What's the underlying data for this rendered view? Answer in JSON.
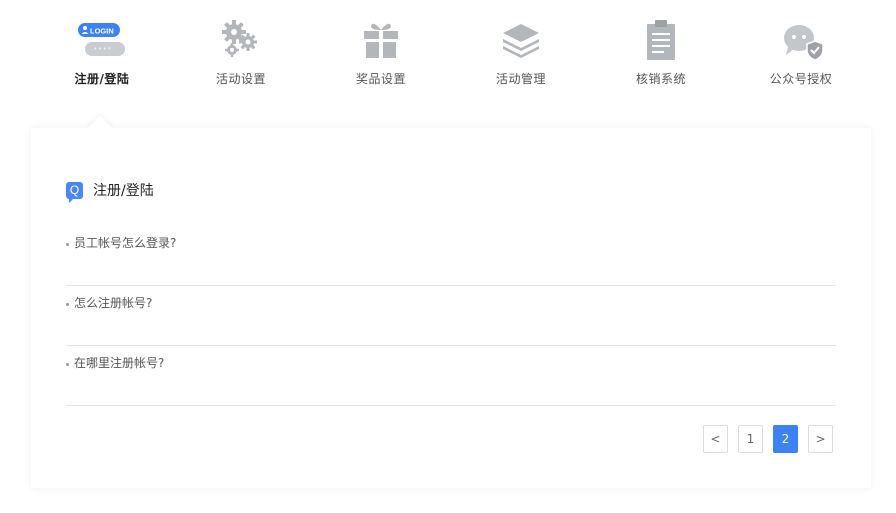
{
  "tabs": [
    {
      "label": "注册/登陆",
      "icon": "login-icon",
      "active": true,
      "badge": "LOGIN",
      "dots": "* * * *"
    },
    {
      "label": "活动设置",
      "icon": "gears-icon",
      "active": false
    },
    {
      "label": "奖品设置",
      "icon": "gift-icon",
      "active": false
    },
    {
      "label": "活动管理",
      "icon": "layers-icon",
      "active": false
    },
    {
      "label": "核销系统",
      "icon": "clipboard-icon",
      "active": false
    },
    {
      "label": "公众号授权",
      "icon": "wechat-shield-icon",
      "active": false
    }
  ],
  "section": {
    "badge": "Q",
    "title": "注册/登陆"
  },
  "faq": [
    {
      "question": "员工帐号怎么登录?"
    },
    {
      "question": "怎么注册帐号?"
    },
    {
      "question": "在哪里注册帐号?"
    }
  ],
  "pager": {
    "prev": "<",
    "pages": [
      "1",
      "2"
    ],
    "current": "2",
    "next": ">"
  },
  "colors": {
    "accent": "#3d82f5",
    "icon_gray": "#b3b6ba"
  }
}
